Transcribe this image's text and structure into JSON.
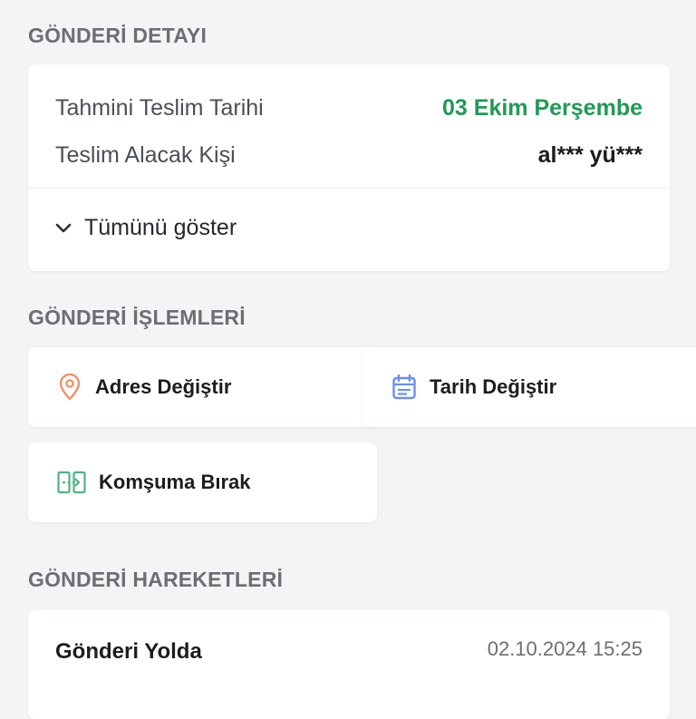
{
  "detail": {
    "title": "GÖNDERİ DETAYI",
    "rows": [
      {
        "label": "Tahmini Teslim Tarihi",
        "value": "03 Ekim Perşembe"
      },
      {
        "label": "Teslim Alacak Kişi",
        "value": "al*** yü***"
      }
    ],
    "expand_label": "Tümünü göster"
  },
  "actions": {
    "title": "GÖNDERİ İŞLEMLERİ",
    "items": [
      {
        "label": "Adres Değiştir",
        "icon": "location-pin-icon"
      },
      {
        "label": "Tarih Değiştir",
        "icon": "calendar-icon"
      },
      {
        "label": "Komşuma Bırak",
        "icon": "transfer-icon"
      }
    ]
  },
  "movements": {
    "title": "GÖNDERİ HAREKETLERİ",
    "items": [
      {
        "status": "Gönderi Yolda",
        "time": "02.10.2024 15:25"
      }
    ]
  },
  "colors": {
    "background": "#f3f4f6",
    "accent_green": "#1f9a55",
    "pin_orange": "#f0926a",
    "calendar_blue": "#6b8ff0",
    "transfer_green": "#4fb383"
  }
}
